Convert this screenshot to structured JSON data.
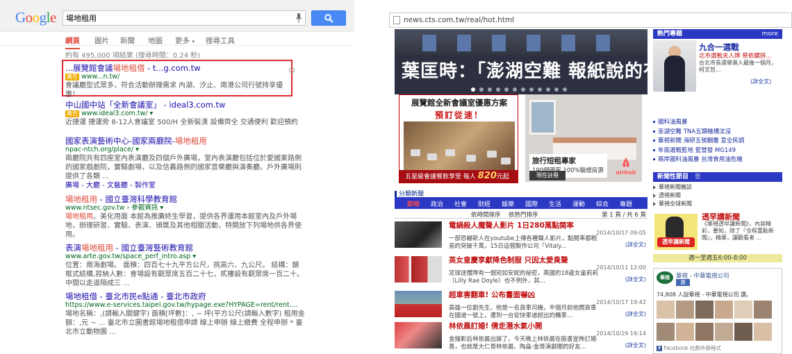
{
  "google": {
    "logo": "Google",
    "query": "場地租用",
    "tabs": [
      "網頁",
      "圖片",
      "新聞",
      "地圖",
      "更多",
      "搜尋工具"
    ],
    "stats": "約有 495,000 項結果 (搜尋時間：0.24 秒)",
    "results": [
      {
        "title_pre": "...展覽館會議",
        "title_kw": "場地租借",
        "title_post": " - t...g.com.tw",
        "ad_badge": "廣告",
        "url": "www...n.tw/",
        "snippet": "會議廳型式眾多，符合活動辦理需求 內湖、汐止、南港公司行號持享優惠！"
      },
      {
        "title": "中山國中站「全新會議室」 - ideal3.com.tw",
        "ad_badge": "廣告",
        "url": "www.ideal3.com.tw/",
        "snippet": "近捷運 捷運旁 8-12人會議室 500/H 全新裝潢 設備齊全 交通便利 歡迎預約"
      },
      {
        "title_pre": "國家表演藝術中心-國家兩廳院-",
        "title_kw": "場地租用",
        "url": "npac-ntch.org/place/",
        "snippet": "兩廳院共有四座室內表演廳及四個戶外廣場，室內表演廳包括位於愛國東路側的國家戲劇院，實驗劇場，以及信義路側的國家音樂廳與演奏廳。戶外廣場則提供了各類 ...",
        "links": "廣場 - 大廳 - 文藝廳 - 製作室"
      },
      {
        "title_kw": "場地租用",
        "title_post": " - 國立臺灣科學教育館",
        "url": "www.ntsec.gov.tw › 參觀資訊",
        "snippet_kw": "場地租用",
        "snippet": "。美化用面 本館為推廣終生學習，提供各界運用本館室內及戶外場地，辦理研習、實驗、表演、頒獎及其他相關活動，特開放下列場地供各界使用。"
      },
      {
        "title_pre": "表演",
        "title_kw": "場地租用",
        "title_post": " - 國立臺灣藝術教育館",
        "url": "www.arte.gov.tw/space_perf_intro.asp",
        "snippet": "位置：南海劇場。 面積：四百七十九平方公尺，挑高六．九公尺。 結構：鏡框式結構,容納人數：會場設有觀眾席五百二十七，貳樓設有觀眾席一百二十。中間以走道隔成三 ..."
      },
      {
        "title": "場地租借 - 臺北市民e點通 - 臺北市政府",
        "url": "https://www.e-services.taipei.gov.tw/hypage.exe?HYPAGE=rent/rent....",
        "snippet": "場地名稱：,(請輸入關鍵字) 面積[坪數]：, ~ 坪(平方公尺(請輸入數字) 租用金額：,元 ~ ... 臺北市立圖書館場地租借申請 線上申辦 線上繳費 全程申辦 * 臺北市立動物園 ..."
      }
    ]
  },
  "cts": {
    "address": "news.cts.com.tw/real/hot.html",
    "banner_headline": "葉匡時：「澎湖空難 報紙說的有誤...",
    "ad1": {
      "line1": "展覽館全新會議室優惠方案",
      "line2": "預訂從速！",
      "footer_pre": "五星級會議餐飲享受 每人",
      "footer_price": "820",
      "footer_post": "元起"
    },
    "ad2": {
      "title": "旅行短租專家",
      "subtitle": "190個國家 100%驗證房源",
      "cta": "現在註冊",
      "brand": "airbnb"
    },
    "section_title": "分類新聞",
    "categories": [
      "即時",
      "政治",
      "社會",
      "財經",
      "娛樂",
      "國際",
      "生活",
      "運動",
      "綜合",
      "專題"
    ],
    "sort_by_time": "依時間排序",
    "sort_by_hot": "依熱門排序",
    "pagination": "第 1 頁 / 共 6 頁",
    "news": [
      {
        "title": "電鍋殺人魔聲人影片 1日280萬點閱率",
        "time": "2014/10/17 09:05",
        "desc": "一部恐嚇新人在youtube上傳各種聲人影片，點閱率都輕易的突破千萬，15日這個製作公司「Vitaly...",
        "more": "(詳全文)"
      },
      {
        "title": "英女皇慶享獻降色制服 只因太愛臭聲",
        "time": "2014/10/11 12:00",
        "desc": "足球迷攬隊有一個宛如安妮的祕密，英國的18歲女童莉莉（Lilly Rae Doyle）也不例外，其...",
        "more": "(詳全文)"
      },
      {
        "title": "超車害翻車! 公布畫面嚇凶",
        "time": "2014/10/17 19:42",
        "desc": "高雄一位劉先生，他是一名貨車司機，半個月前他開貨車在國道一號上，遭到一台從快車道超出的轎車...",
        "more": "(詳全文)"
      },
      {
        "title": "林依晨訂婚! 倩走潛水氣小開",
        "time": "2014/10/29 19:14",
        "desc": "金鐘影后林依晨出嫁了，今天晚上林依晨在臉書宣佈訂婚喜，也就是大仁哥林依晨、陶晶·金哥演劇關的好友...",
        "more": "(詳全文)"
      }
    ],
    "hot_topics_header": "熱門專題",
    "more": "more",
    "featured": {
      "title": "九合一選戰",
      "subtitle": "北市選戰夫人牌 祭依嫻拼...",
      "desc": "台北市長選舉進入最後一個月，柯文哲...",
      "more": "(詳全文)"
    },
    "hot_list": [
      "國科油風暴",
      "澎湖空難 TNA五類機構沈沒",
      "華視新聞 海研五號翻覆 意全民調",
      "年底選戰藍地 藍營發 MG149",
      "兩岸國科油風暴 台灣食用油危機"
    ],
    "program_header": "新聞性節目",
    "programs": [
      "華視新聞雜誌",
      "透視新聞",
      "華視全球新聞"
    ],
    "program_feature": {
      "title": "透早講新聞",
      "badge": "透早講新聞",
      "desc": "《華視透早講新聞》，內容精彩，要知，除了『全程重點新聞』，精華，讓觀看者 ...",
      "airtime": "週一至週五6:00-8:00"
    },
    "facebook": {
      "logo": "華視",
      "page_name": "華視 - 中華電視公司",
      "like": "讚",
      "count": "74,808 人說華視 - 中華電視公司 讚。",
      "footer": "Facebook 社群外掛程式"
    }
  }
}
